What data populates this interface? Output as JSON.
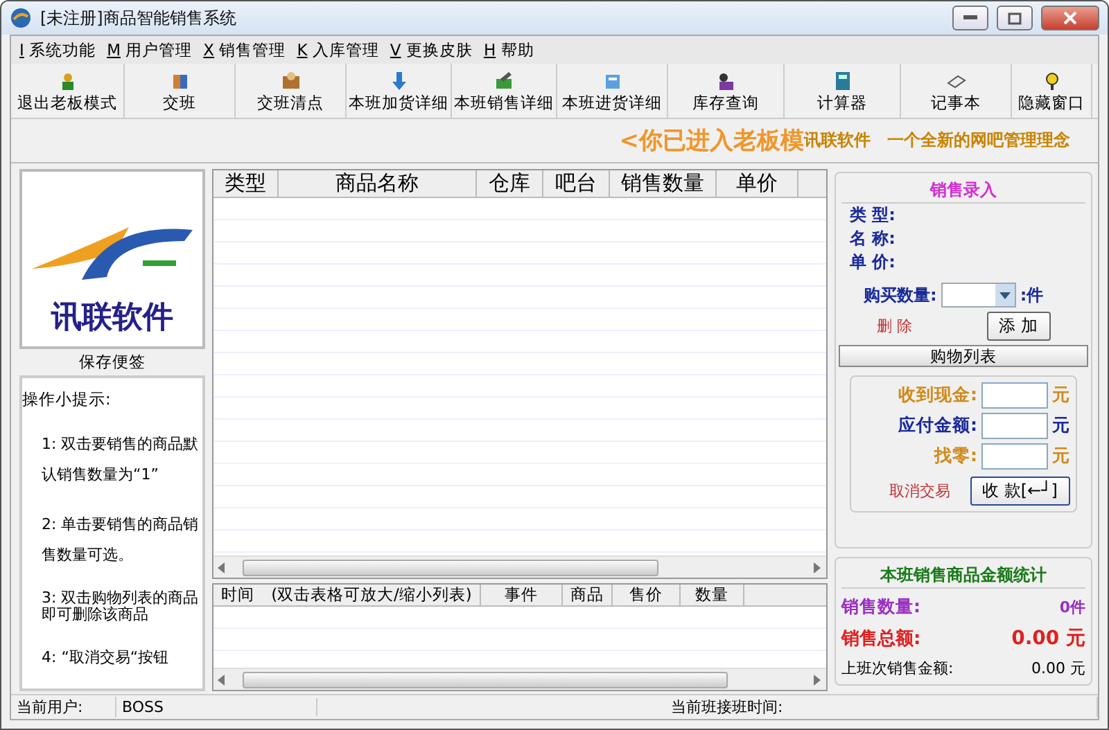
{
  "window": {
    "title": "[未注册]商品智能销售系统"
  },
  "menu": [
    {
      "key": "I",
      "label": "系统功能"
    },
    {
      "key": "M",
      "label": "用户管理"
    },
    {
      "key": "X",
      "label": "销售管理"
    },
    {
      "key": "K",
      "label": "入库管理"
    },
    {
      "key": "V",
      "label": "更换皮肤"
    },
    {
      "key": "H",
      "label": "帮助"
    }
  ],
  "toolbar": [
    "退出老板模式",
    "交班",
    "交班清点",
    "本班加货详细",
    "本班销售详细",
    "本班进货详细",
    "库存查询",
    "计算器",
    "记事本",
    "隐藏窗口"
  ],
  "banner": {
    "mode": "<你已进入老板模",
    "slogan": "讯联软件　一个全新的网吧管理理念"
  },
  "logo": {
    "name": "讯联软件",
    "caption": "保存便签"
  },
  "tips": {
    "title": "操作小提示:",
    "items": [
      "1: 双击要销售的商品默认销售数量为“1”",
      "2: 单击要销售的商品销售数量可选。",
      "3: 双击购物列表的商品即可删除该商品",
      "4: “取消交易“按钮"
    ]
  },
  "goods_table": {
    "columns": [
      "类型",
      "商品名称",
      "仓库",
      "吧台",
      "销售数量",
      "单价"
    ]
  },
  "log_table": {
    "columns": [
      "时间　(双击表格可放大/缩小列表)",
      "事件",
      "商品",
      "售价",
      "数量"
    ]
  },
  "sales_entry": {
    "title": "销售录入",
    "fields": [
      "类 型:",
      "名 称:",
      "单 价:"
    ],
    "quantity_label": "购买数量:",
    "quantity_unit": ":件",
    "delete": "删 除",
    "add": "添 加",
    "cart": "购物列表",
    "payment": [
      {
        "label": "收到现金:",
        "unit": "元",
        "color": "#d08a1a"
      },
      {
        "label": "应付金额:",
        "unit": "元",
        "color": "#1a2a9a"
      },
      {
        "label": "找零:",
        "unit": "元",
        "color": "#d08a1a"
      }
    ],
    "cancel": "取消交易",
    "pay": "收 款[←┘]"
  },
  "stats": {
    "title": "本班销售商品金额统计",
    "count_label": "销售数量:",
    "count": "0件",
    "total_label": "销售总额:",
    "total": "0.00 元",
    "last_label": "上班次销售金额:",
    "last": "0.00 元"
  },
  "status_bar": {
    "user_label": "当前用户:",
    "user": "BOSS",
    "shift_label": "当前班接班时间:"
  }
}
